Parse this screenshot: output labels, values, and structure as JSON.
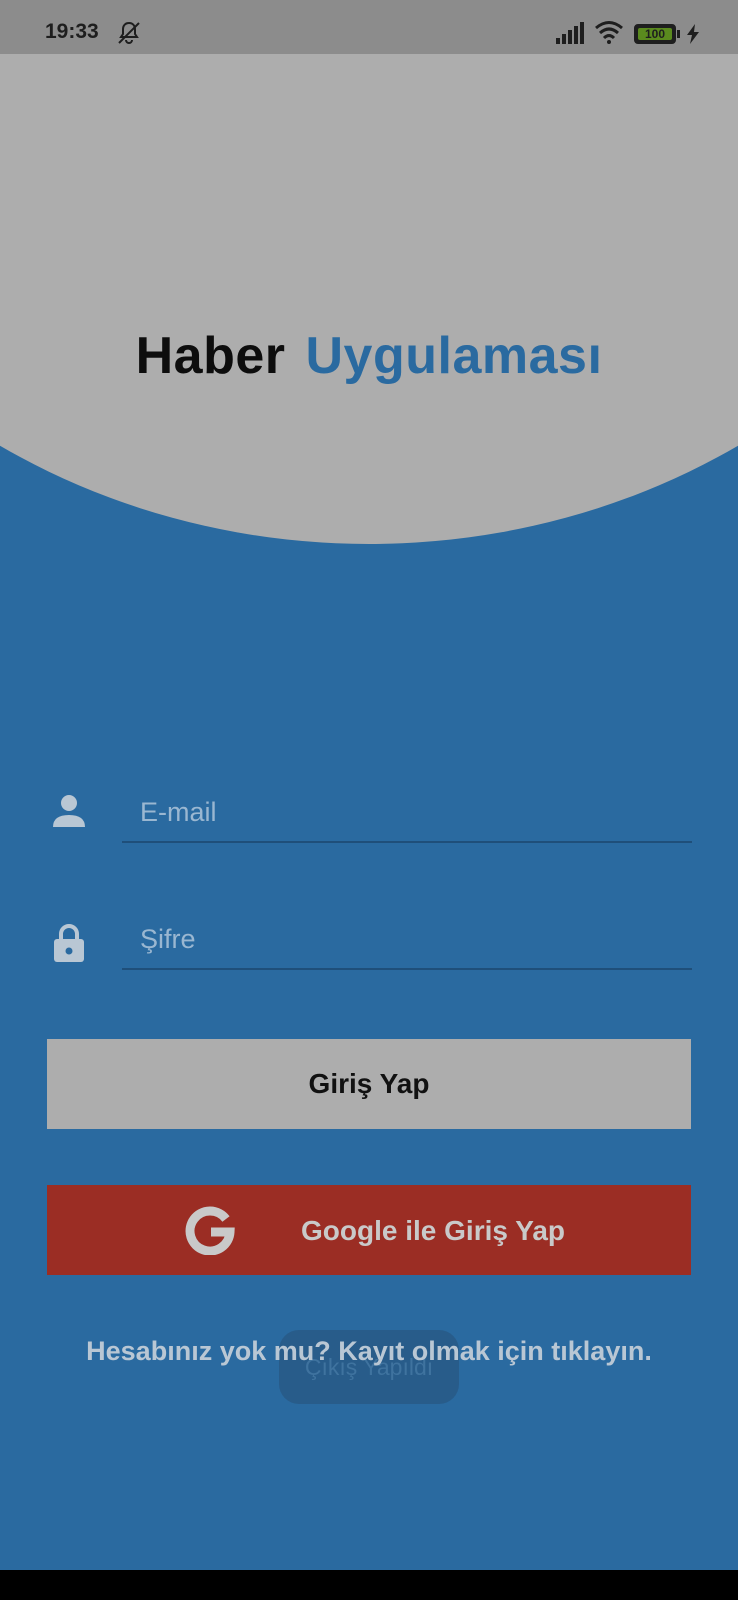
{
  "status_bar": {
    "time": "19:33",
    "battery": "100",
    "icons": [
      "bell-off-icon",
      "signal-icon",
      "wifi-icon",
      "battery-icon",
      "charging-icon"
    ]
  },
  "header": {
    "title_part1": "Haber",
    "title_part2": "Uygulaması"
  },
  "form": {
    "email_placeholder": "E-mail",
    "email_value": "",
    "password_placeholder": "Şifre",
    "password_value": "",
    "login_button": "Giriş Yap",
    "google_button": "Google ile Giriş Yap",
    "signup_link": "Hesabınız yok mu? Kayıt olmak için tıklayın."
  },
  "toast": {
    "text": "Çıkış Yapıldı"
  },
  "colors": {
    "background": "#2a6aa0",
    "header_gray": "#adadad",
    "accent_blue": "#2a6aa0",
    "google_red": "#9b2d24"
  }
}
